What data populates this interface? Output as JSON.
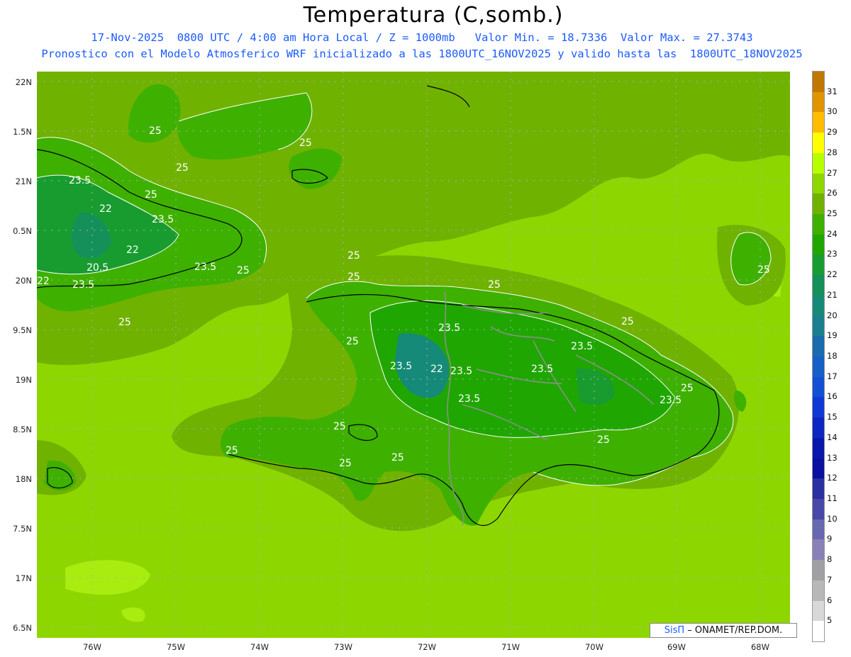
{
  "header": {
    "title": "Temperatura (C,somb.)",
    "line1": "17-Nov-2025  0800 UTC / 4:00 am Hora Local / Z = 1000mb   Valor Min. = 18.7336  Valor Max. = 27.3743",
    "line2": "Pronostico con el Modelo Atmosferico WRF inicializado a las 1800UTC_16NOV2025 y valido hasta las  1800UTC_18NOV2025"
  },
  "axes": {
    "lat_labels": [
      "22N",
      "1.5N",
      "21N",
      "0.5N",
      "20N",
      "9.5N",
      "19N",
      "8.5N",
      "18N",
      "7.5N",
      "17N",
      "6.5N"
    ],
    "lon_labels": [
      "76W",
      "75W",
      "74W",
      "73W",
      "72W",
      "71W",
      "70W",
      "69W",
      "68W"
    ]
  },
  "contour_labels": [
    "25",
    "25",
    "25",
    "23.5",
    "25",
    "22",
    "23.5",
    "22",
    "20.5",
    "23.5",
    "23.5",
    "25",
    "22",
    "25",
    "25",
    "25",
    "23.5",
    "25",
    "25",
    "23.5",
    "22",
    "23.5",
    "23.5",
    "23.5",
    "23.5",
    "25",
    "25",
    "23.5",
    "25",
    "25",
    "25",
    "25",
    "25",
    "25"
  ],
  "credit": {
    "sis": "SisΠ",
    "rest": "– ONAMET/REP.DOM."
  },
  "colorbar": {
    "labels": [
      "31",
      "30",
      "29",
      "28",
      "27",
      "26",
      "25",
      "24",
      "23",
      "22",
      "21",
      "20",
      "19",
      "18",
      "17",
      "16",
      "15",
      "14",
      "13",
      "12",
      "11",
      "10",
      "9",
      "8",
      "7",
      "6",
      "5"
    ],
    "colors": [
      "#c07800",
      "#e09400",
      "#ffbc00",
      "#ffff00",
      "#b8ff00",
      "#8ed600",
      "#70b200",
      "#3eb000",
      "#20a600",
      "#189c30",
      "#15905a",
      "#168a78",
      "#1a8090",
      "#1a6cac",
      "#1660c8",
      "#1450d4",
      "#1038d4",
      "#0c28c0",
      "#0818ac",
      "#0a10a0",
      "#2a30a0",
      "#4848a8",
      "#6868b0",
      "#8a80b8",
      "#a0a0a4",
      "#b8b8b8",
      "#d8d8d8",
      "#ffffff"
    ]
  },
  "colors": {
    "background": "#8ed600",
    "contour_line": "#ffffff",
    "coast": "#000000",
    "border": "#909090"
  }
}
